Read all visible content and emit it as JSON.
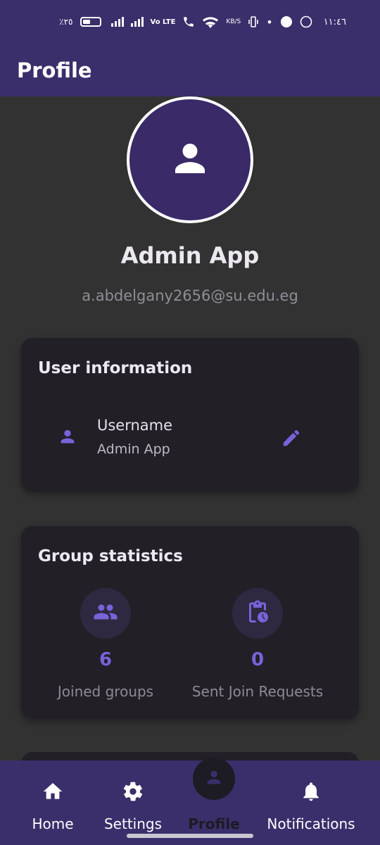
{
  "status_bar": {
    "battery": "٪٢٥",
    "network": "Vo LTE",
    "speed": "KB/S",
    "time": "١١:٤٦"
  },
  "app_bar": {
    "title": "Profile"
  },
  "profile": {
    "name": "Admin App",
    "email": "a.abdelgany2656@su.edu.eg",
    "avatar_icon": "person-icon"
  },
  "user_info": {
    "title": "User information",
    "username_label": "Username",
    "username_value": "Admin App",
    "edit_icon": "pencil-icon"
  },
  "group_stats": {
    "title": "Group statistics",
    "joined": {
      "value": "6",
      "label": "Joined groups",
      "icon": "group-icon"
    },
    "requests": {
      "value": "0",
      "label": "Sent Join Requests",
      "icon": "clipboard-clock-icon"
    }
  },
  "nav": {
    "items": [
      {
        "label": "Home",
        "icon": "home-icon"
      },
      {
        "label": "Settings",
        "icon": "gear-icon"
      },
      {
        "label": "Profile",
        "icon": "person-icon",
        "active": true
      },
      {
        "label": "Notifications",
        "icon": "bell-icon"
      }
    ]
  },
  "colors": {
    "primary": "#3a2f6b",
    "accent": "#7a62d8",
    "background": "#323232",
    "card": "#221f27"
  }
}
